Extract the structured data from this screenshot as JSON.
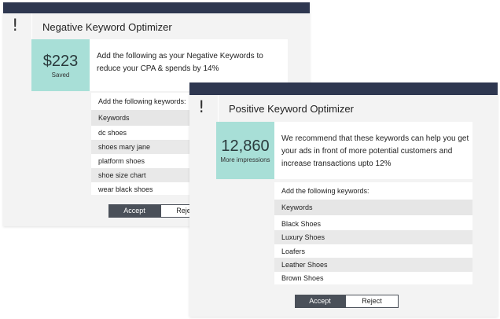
{
  "negative_card": {
    "alert_symbol": "!",
    "title": "Negative Keyword Optimizer",
    "metric_value": "$223",
    "metric_caption": "Saved",
    "description": "Add the following as your Negative Keywords to reduce your CPA & spends by 14%",
    "keywords_prompt": "Add the following keywords:",
    "keywords_header": "Keywords",
    "keywords": [
      "dc shoes",
      "shoes mary jane",
      "platform shoes",
      "shoe size chart",
      "wear black shoes"
    ],
    "accept_label": "Accept",
    "reject_label": "Reject"
  },
  "positive_card": {
    "alert_symbol": "!",
    "title": "Positive Keyword Optimizer",
    "metric_value": "12,860",
    "metric_caption": "More impressions",
    "description": "We recommend that these keywords can help you get your ads in front of more potential customers and increase transactions upto 12%",
    "keywords_prompt": "Add the following keywords:",
    "keywords_header": "Keywords",
    "keywords": [
      "Black Shoes",
      "Luxury Shoes",
      "Loafers",
      "Leather Shoes",
      "Brown Shoes"
    ],
    "accept_label": "Accept",
    "reject_label": "Reject"
  }
}
